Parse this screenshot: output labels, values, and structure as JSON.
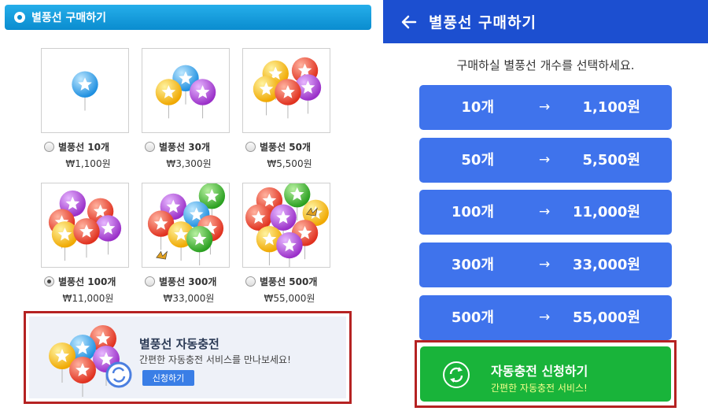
{
  "desktop": {
    "header_title": "별풍선 구매하기",
    "items": [
      {
        "label": "별풍선 10개",
        "price": "₩1,100원",
        "checked": false
      },
      {
        "label": "별풍선 30개",
        "price": "₩3,300원",
        "checked": false
      },
      {
        "label": "별풍선 50개",
        "price": "₩5,500원",
        "checked": false
      },
      {
        "label": "별풍선 100개",
        "price": "₩11,000원",
        "checked": true
      },
      {
        "label": "별풍선 300개",
        "price": "₩33,000원",
        "checked": false
      },
      {
        "label": "별풍선 500개",
        "price": "₩55,000원",
        "checked": false
      }
    ],
    "auto_charge": {
      "title": "별풍선 자동충전",
      "subtitle": "간편한 자동충전 서비스를 만나보세요!",
      "button_label": "신청하기"
    }
  },
  "mobile": {
    "header_title": "별풍선 구매하기",
    "prompt": "구매하실 별풍선 개수를 선택하세요.",
    "arrow_symbol": "→",
    "options": [
      {
        "count": "10개",
        "price": "1,100원"
      },
      {
        "count": "50개",
        "price": "5,500원"
      },
      {
        "count": "100개",
        "price": "11,000원"
      },
      {
        "count": "300개",
        "price": "33,000원"
      },
      {
        "count": "500개",
        "price": "55,000원"
      }
    ],
    "auto_charge": {
      "title": "자동충전 신청하기",
      "subtitle": "간편한 자동충전 서비스!"
    }
  },
  "colors": {
    "desktop_header": "#0a8ccf",
    "mobile_header": "#1c4fd0",
    "option_button": "#3f73ec",
    "auto_charge_green": "#19b43a",
    "highlight_border": "#b52222"
  },
  "icons": [
    "balloon-icon",
    "radio-icon",
    "back-arrow-icon",
    "refresh-icon"
  ]
}
